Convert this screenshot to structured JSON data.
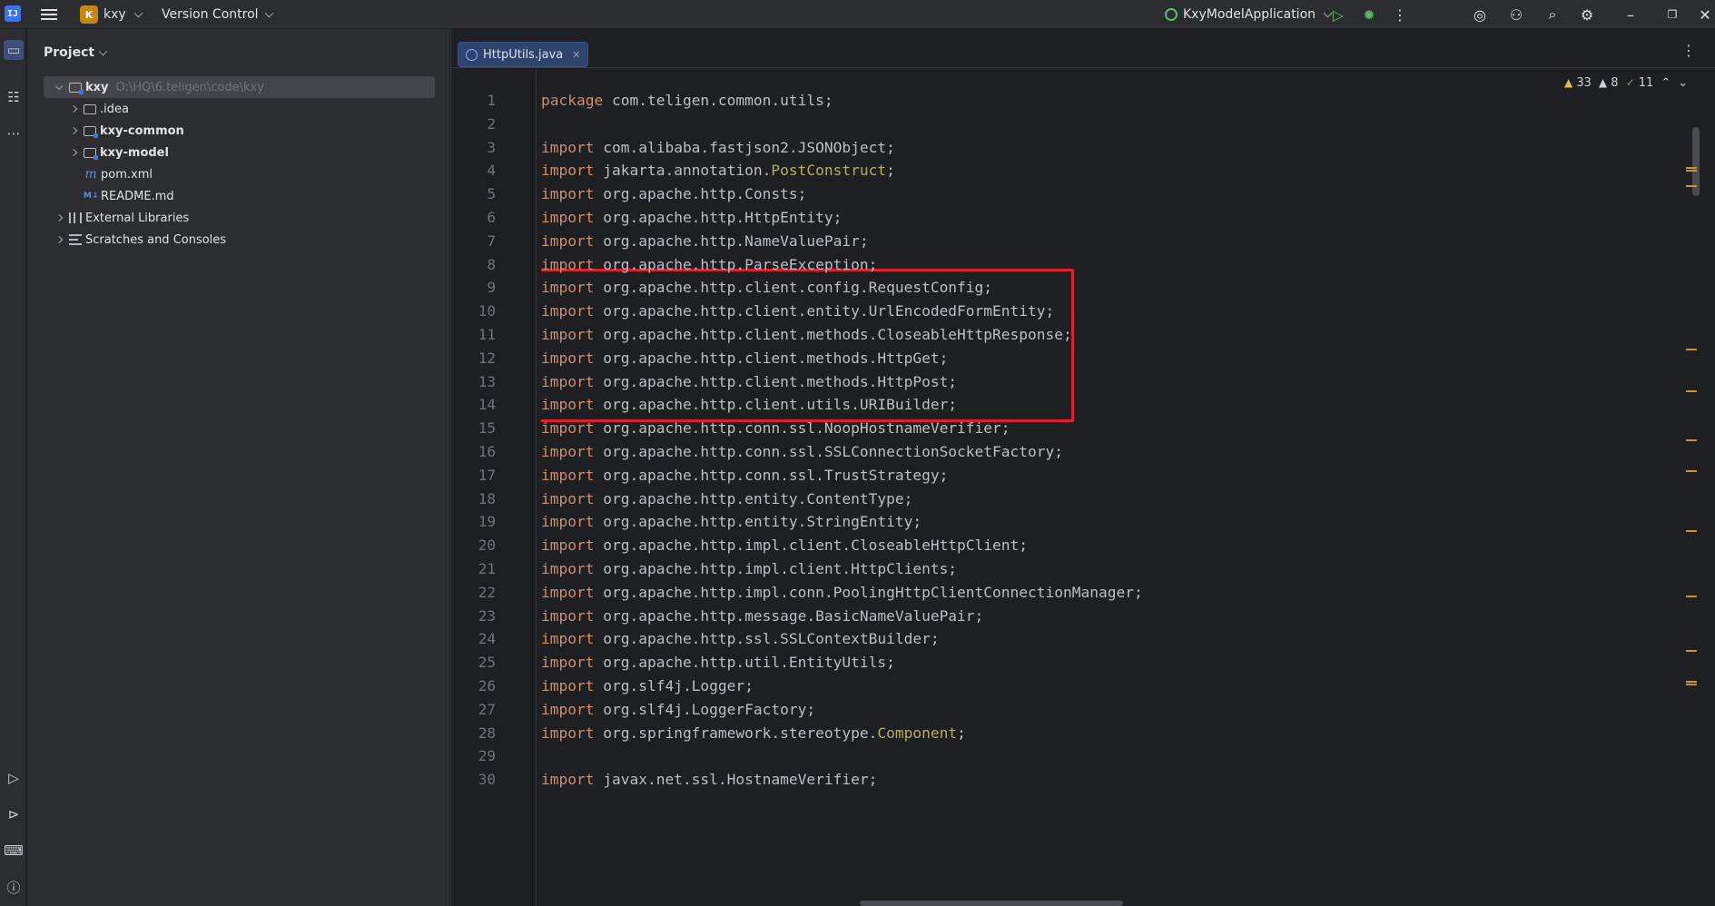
{
  "titlebar": {
    "project_badge": "K",
    "project_name": "kxy",
    "vcs_label": "Version Control",
    "run_config": "KxyModelApplication"
  },
  "project_panel": {
    "header": "Project",
    "tree": [
      {
        "label": "kxy",
        "hint": "O:\\HQ\\6.teligen\\code\\kxy",
        "type": "module-folder",
        "expanded": true,
        "bold": true
      },
      {
        "label": ".idea",
        "type": "folder",
        "expanded": false,
        "bold": false
      },
      {
        "label": "kxy-common",
        "type": "module-folder",
        "expanded": false,
        "bold": true
      },
      {
        "label": "kxy-model",
        "type": "module-folder",
        "expanded": false,
        "bold": true
      },
      {
        "label": "pom.xml",
        "type": "maven",
        "bold": false
      },
      {
        "label": "README.md",
        "type": "markdown",
        "bold": false
      },
      {
        "label": "External Libraries",
        "type": "library",
        "expanded": false,
        "bold": false
      },
      {
        "label": "Scratches and Consoles",
        "type": "scratches",
        "expanded": false,
        "bold": false
      }
    ]
  },
  "editor": {
    "tab_label": "HttpUtils.java",
    "inspections": {
      "warnings": "33",
      "weak_warnings": "8",
      "ok": "11"
    },
    "highlight_lines": [
      9,
      14
    ],
    "lines": [
      {
        "n": "1",
        "kw": "package",
        "rest": " com.teligen.common.utils;"
      },
      {
        "n": "2",
        "kw": "",
        "rest": ""
      },
      {
        "n": "3",
        "kw": "import",
        "rest": " com.alibaba.fastjson2.JSONObject;"
      },
      {
        "n": "4",
        "kw": "import",
        "rest": " jakarta.annotation.",
        "ann": "PostConstruct",
        "tail": ";"
      },
      {
        "n": "5",
        "kw": "import",
        "rest": " org.apache.http.Consts;"
      },
      {
        "n": "6",
        "kw": "import",
        "rest": " org.apache.http.HttpEntity;"
      },
      {
        "n": "7",
        "kw": "import",
        "rest": " org.apache.http.NameValuePair;"
      },
      {
        "n": "8",
        "kw": "import",
        "rest": " org.apache.http.ParseException;"
      },
      {
        "n": "9",
        "kw": "import",
        "rest": " org.apache.http.client.config.RequestConfig;"
      },
      {
        "n": "10",
        "kw": "import",
        "rest": " org.apache.http.client.entity.UrlEncodedFormEntity;"
      },
      {
        "n": "11",
        "kw": "import",
        "rest": " org.apache.http.client.methods.CloseableHttpResponse;"
      },
      {
        "n": "12",
        "kw": "import",
        "rest": " org.apache.http.client.methods.HttpGet;"
      },
      {
        "n": "13",
        "kw": "import",
        "rest": " org.apache.http.client.methods.HttpPost;"
      },
      {
        "n": "14",
        "kw": "import",
        "rest": " org.apache.http.client.utils.URIBuilder;"
      },
      {
        "n": "15",
        "kw": "import",
        "rest": " org.apache.http.conn.ssl.NoopHostnameVerifier;"
      },
      {
        "n": "16",
        "kw": "import",
        "rest": " org.apache.http.conn.ssl.SSLConnectionSocketFactory;"
      },
      {
        "n": "17",
        "kw": "import",
        "rest": " org.apache.http.conn.ssl.TrustStrategy;"
      },
      {
        "n": "18",
        "kw": "import",
        "rest": " org.apache.http.entity.ContentType;"
      },
      {
        "n": "19",
        "kw": "import",
        "rest": " org.apache.http.entity.StringEntity;"
      },
      {
        "n": "20",
        "kw": "import",
        "rest": " org.apache.http.impl.client.CloseableHttpClient;"
      },
      {
        "n": "21",
        "kw": "import",
        "rest": " org.apache.http.impl.client.HttpClients;"
      },
      {
        "n": "22",
        "kw": "import",
        "rest": " org.apache.http.impl.conn.PoolingHttpClientConnectionManager;"
      },
      {
        "n": "23",
        "kw": "import",
        "rest": " org.apache.http.message.BasicNameValuePair;"
      },
      {
        "n": "24",
        "kw": "import",
        "rest": " org.apache.http.ssl.SSLContextBuilder;"
      },
      {
        "n": "25",
        "kw": "import",
        "rest": " org.apache.http.util.EntityUtils;"
      },
      {
        "n": "26",
        "kw": "import",
        "rest": " org.slf4j.Logger;"
      },
      {
        "n": "27",
        "kw": "import",
        "rest": " org.slf4j.LoggerFactory;"
      },
      {
        "n": "28",
        "kw": "import",
        "rest": " org.springframework.stereotype.",
        "ann": "Component",
        "tail": ";"
      },
      {
        "n": "29",
        "kw": "",
        "rest": ""
      },
      {
        "n": "30",
        "kw": "import",
        "rest": " javax.net.ssl.HostnameVerifier;"
      }
    ]
  },
  "colors": {
    "keyword": "#cf8e6d",
    "annotation": "#b3ae60",
    "text": "#bcbec4",
    "highlight_box": "#e0202a",
    "background": "#1e1f22",
    "panel": "#2b2d30"
  }
}
